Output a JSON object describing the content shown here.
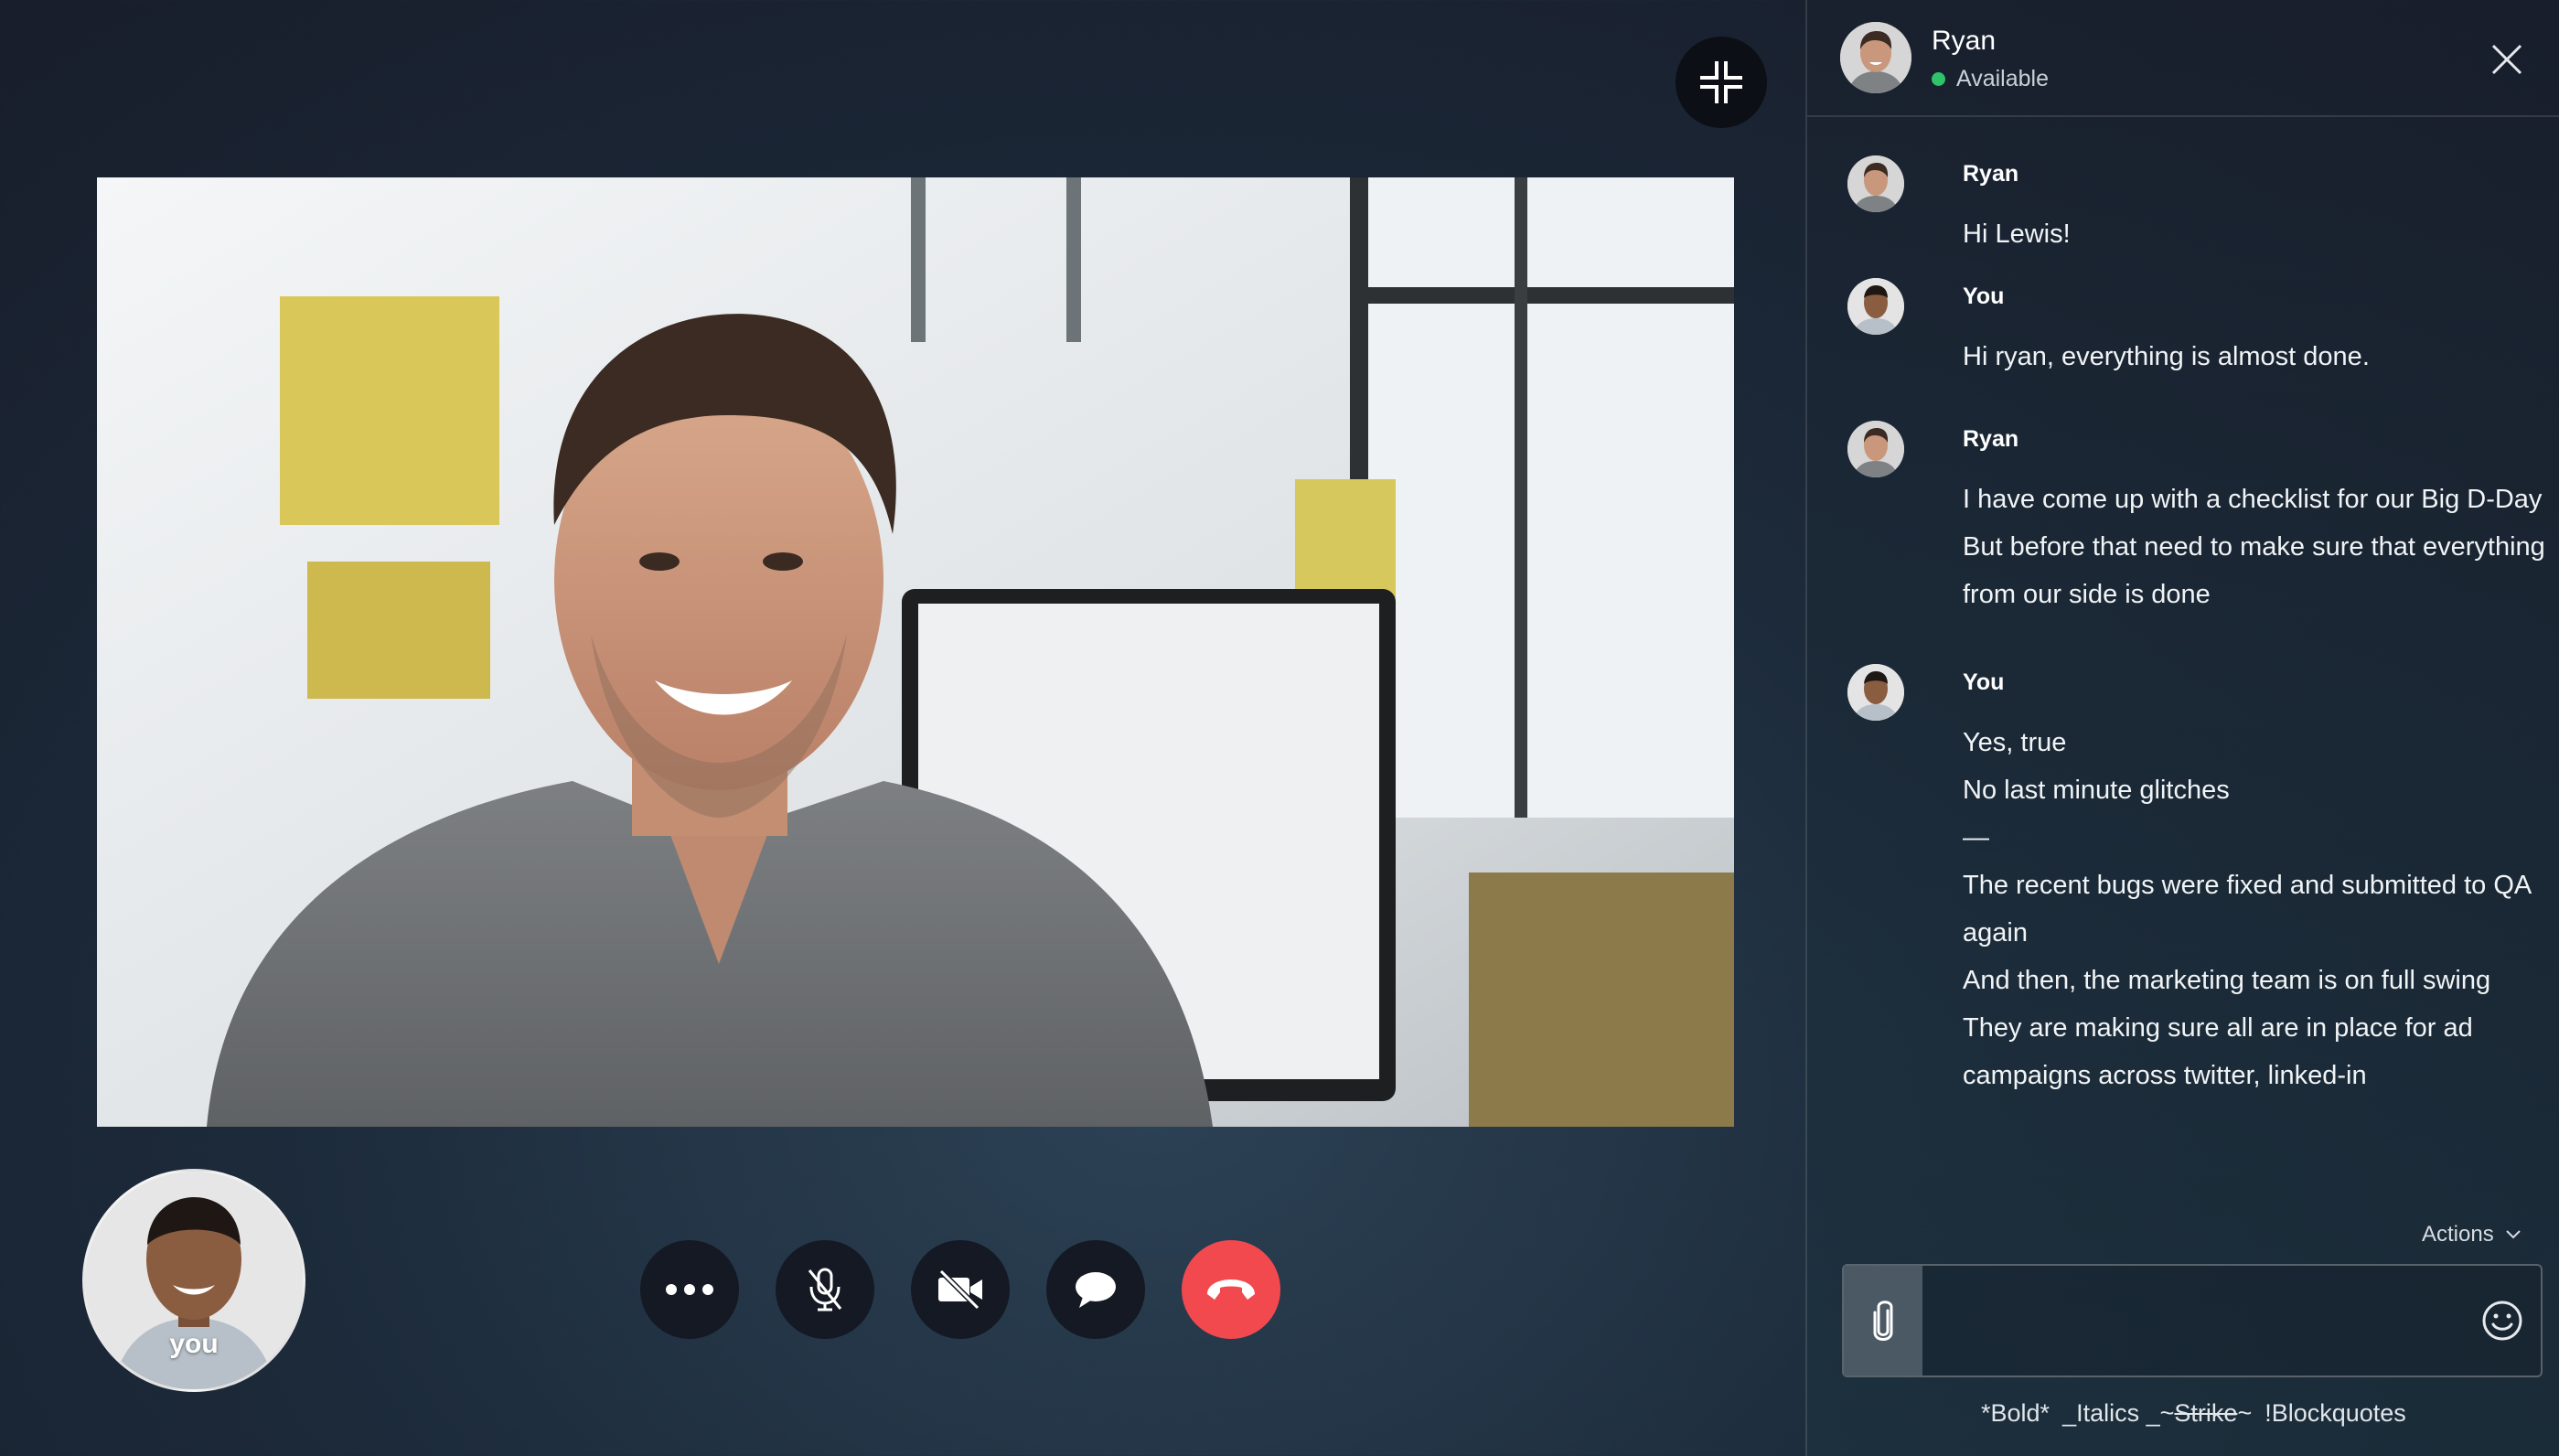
{
  "call": {
    "main_participant": "Ryan",
    "self_label": "you"
  },
  "controls": [
    {
      "name": "more-options",
      "icon": "more-dots-icon"
    },
    {
      "name": "mute-microphone",
      "icon": "mic-off-icon"
    },
    {
      "name": "toggle-video",
      "icon": "video-off-icon"
    },
    {
      "name": "open-chat",
      "icon": "chat-bubble-icon"
    },
    {
      "name": "end-call",
      "icon": "hangup-icon"
    }
  ],
  "chat": {
    "header": {
      "name": "Ryan",
      "status": "Available",
      "status_color": "#2fc36a"
    },
    "messages": [
      {
        "sender": "Ryan",
        "lines": [
          "Hi Lewis!"
        ]
      },
      {
        "sender": "You",
        "lines": [
          "Hi ryan, everything is almost done."
        ]
      },
      {
        "sender": "Ryan",
        "lines": [
          "I have come up with a checklist for our Big D-Day",
          "But before that need to make sure that everything",
          "from our side is done"
        ]
      },
      {
        "sender": "You",
        "lines": [
          "Yes, true",
          "No last minute glitches",
          "—",
          "The recent bugs were fixed and submitted to QA",
          "again",
          "And then, the marketing team is on full swing",
          "They are making sure all are in place for ad",
          "campaigns across twitter, linked-in"
        ]
      }
    ],
    "actions_label": "Actions",
    "composer": {
      "placeholder": "",
      "value": ""
    },
    "format_hints": {
      "bold": "*Bold*",
      "italics": "_Italics _",
      "strike_prefix": "~",
      "strike": "Strike",
      "strike_suffix": "~",
      "blockquotes": "!Blockquotes"
    }
  },
  "colors": {
    "end_call": "#f2494f",
    "attach_bg": "#4b5965",
    "available": "#2fc36a"
  }
}
